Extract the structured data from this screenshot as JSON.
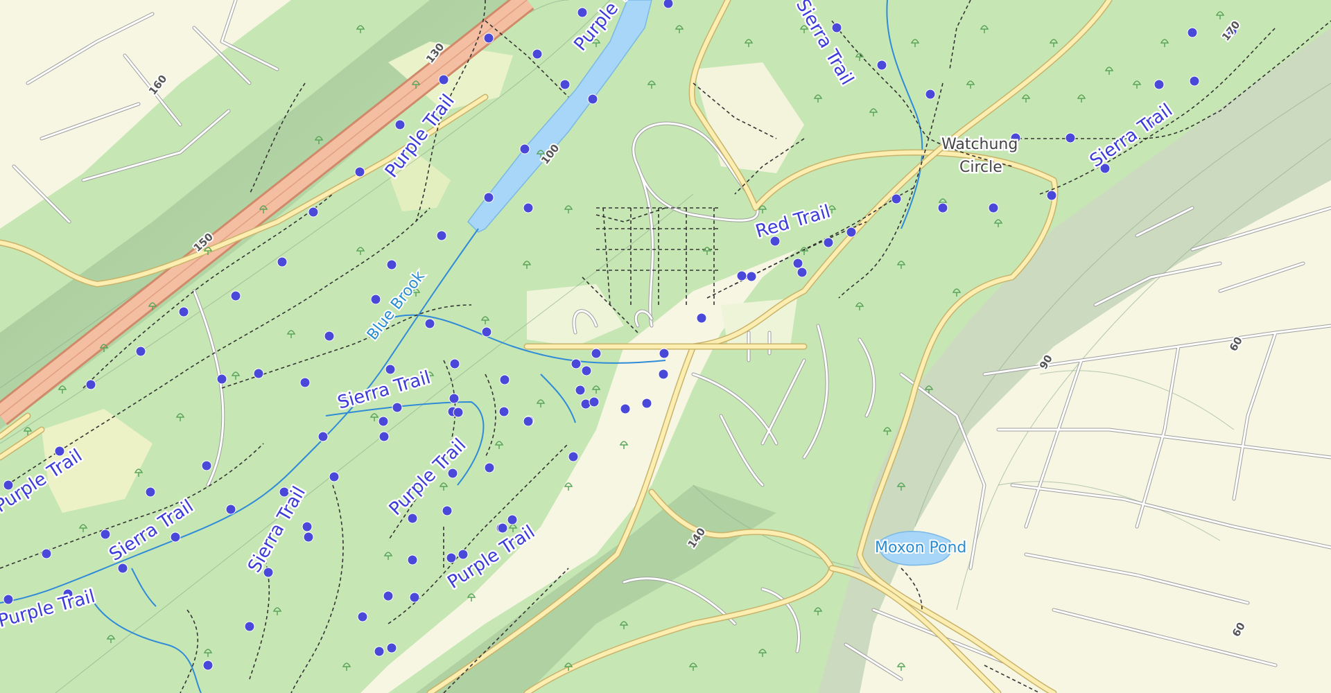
{
  "map": {
    "trail_labels": [
      {
        "text": "Purple Trail",
        "id": "purple-1"
      },
      {
        "text": "Purple Trail",
        "id": "purple-2"
      },
      {
        "text": "Purple Trail",
        "id": "purple-3"
      },
      {
        "text": "Purple Trail",
        "id": "purple-4"
      },
      {
        "text": "Purple Trail",
        "id": "purple-5"
      },
      {
        "text": "Purple Trail",
        "id": "purple-6"
      },
      {
        "text": "Sierra Trail",
        "id": "sierra-1"
      },
      {
        "text": "Sierra Trail",
        "id": "sierra-2"
      },
      {
        "text": "Sierra Trail",
        "id": "sierra-3"
      },
      {
        "text": "Sierra Trail",
        "id": "sierra-4"
      },
      {
        "text": "Sierra Trail",
        "id": "sierra-5"
      },
      {
        "text": "Red Trail",
        "id": "red-1"
      }
    ],
    "water_labels": {
      "brook": "Blue Brook",
      "pond": "Moxon Pond"
    },
    "place_labels": {
      "circle_line1": "Watchung",
      "circle_line2": "Circle"
    },
    "elevation_labels": [
      "160",
      "130",
      "150",
      "100",
      "170",
      "60",
      "90",
      "140",
      "60"
    ],
    "colors": {
      "forest": "#c6e6b4",
      "forest_dark": "#a9d095",
      "residential": "#f6f6e3",
      "water": "#a8d6f8",
      "highway": "#f0b89a",
      "trail_marker": "#4a48d9"
    }
  }
}
